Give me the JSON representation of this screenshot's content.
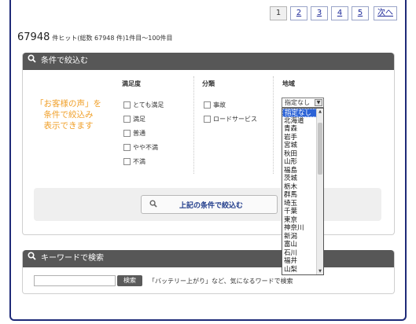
{
  "pagination": {
    "pages": [
      "1",
      "2",
      "3",
      "4",
      "5"
    ],
    "current": "1",
    "next_label": "次へ"
  },
  "results": {
    "count": "67948",
    "summary": "件ヒット(総数 67948 件)1件目～100件目"
  },
  "filter_panel": {
    "title": "条件で絞込む",
    "promo_lines": [
      "「お客様の声」を",
      "条件で絞込み",
      "表示できます"
    ],
    "satisfaction": {
      "title": "満足度",
      "options": [
        "とても満足",
        "満足",
        "普通",
        "やや不満",
        "不満"
      ]
    },
    "category": {
      "title": "分類",
      "options": [
        "事故",
        "ロードサービス"
      ]
    },
    "region": {
      "title": "地域",
      "selected": "指定なし",
      "options": [
        "指定なし",
        "北海道",
        "青森",
        "岩手",
        "宮城",
        "秋田",
        "山形",
        "福島",
        "茨城",
        "栃木",
        "群馬",
        "埼玉",
        "千葉",
        "東京",
        "神奈川",
        "新潟",
        "富山",
        "石川",
        "福井",
        "山梨"
      ]
    },
    "submit_label": "上記の条件で絞込む"
  },
  "keyword_panel": {
    "title": "キーワードで検索",
    "input_value": "",
    "button_label": "検索",
    "hint": "「バッテリー上がり」など、気になるワードで検索"
  }
}
